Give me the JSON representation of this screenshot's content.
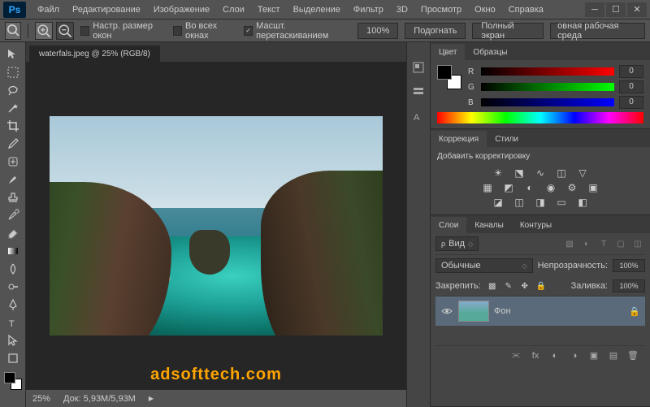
{
  "app_logo": "Ps",
  "menu": [
    "Файл",
    "Редактирование",
    "Изображение",
    "Слои",
    "Текст",
    "Выделение",
    "Фильтр",
    "3D",
    "Просмотр",
    "Окно",
    "Справка"
  ],
  "options": {
    "resize_windows": "Настр. размер окон",
    "all_windows": "Во всех окнах",
    "scrubby_zoom": "Масшт. перетаскиванием",
    "scrubby_checked": "✓",
    "zoom_pct": "100%",
    "fit": "Подогнать",
    "fullscreen": "Полный экран",
    "workspace": "овная рабочая среда"
  },
  "document": {
    "tab": "waterfals.jpeg @ 25% (RGB/8)",
    "watermark": "adsofttech.com"
  },
  "status": {
    "zoom": "25%",
    "doc_size": "Док: 5,93M/5,93M"
  },
  "panels": {
    "color": {
      "tabs": [
        "Цвет",
        "Образцы"
      ],
      "r_label": "R",
      "g_label": "G",
      "b_label": "B",
      "r_val": "0",
      "g_val": "0",
      "b_val": "0"
    },
    "adjustments": {
      "tabs": [
        "Коррекция",
        "Стили"
      ],
      "hint": "Добавить корректировку"
    },
    "layers": {
      "tabs": [
        "Слои",
        "Каналы",
        "Контуры"
      ],
      "kind_label": "Вид",
      "blend_mode": "Обычные",
      "opacity_label": "Непрозрачность:",
      "opacity_val": "100%",
      "lock_label": "Закрепить:",
      "fill_label": "Заливка:",
      "fill_val": "100%",
      "layer_name": "Фон"
    }
  }
}
